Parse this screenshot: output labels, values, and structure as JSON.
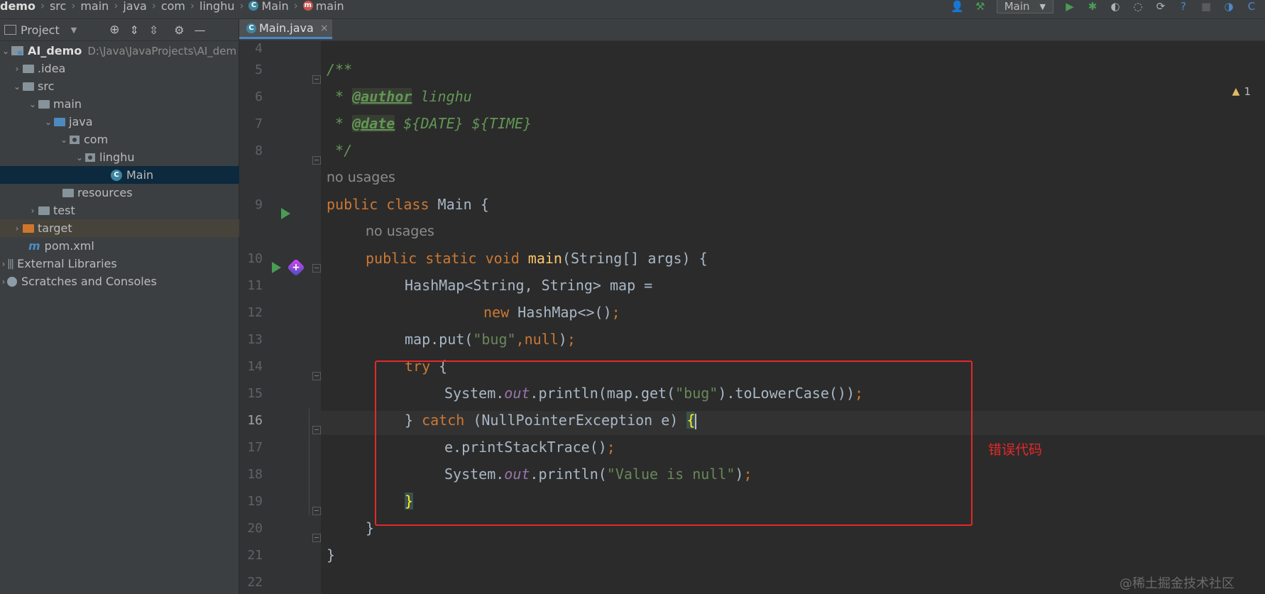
{
  "breadcrumb": {
    "items": [
      "demo",
      "src",
      "main",
      "java",
      "com",
      "linghu",
      "Main",
      "main"
    ]
  },
  "toolbar": {
    "run_config": "Main"
  },
  "project_panel": {
    "title": "Project",
    "tree": [
      {
        "label": "AI_demo",
        "path": "D:\\Java\\JavaProjects\\AI_dem"
      },
      {
        "label": ".idea"
      },
      {
        "label": "src"
      },
      {
        "label": "main"
      },
      {
        "label": "java"
      },
      {
        "label": "com"
      },
      {
        "label": "linghu"
      },
      {
        "label": "Main"
      },
      {
        "label": "resources"
      },
      {
        "label": "test"
      },
      {
        "label": "target"
      },
      {
        "label": "pom.xml"
      },
      {
        "label": "External Libraries"
      },
      {
        "label": "Scratches and Consoles"
      }
    ]
  },
  "editor": {
    "tab": "Main.java",
    "tab_close": "×",
    "warning_count": "1",
    "line_numbers": [
      "4",
      "5",
      "6",
      "7",
      "8",
      "9",
      "10",
      "11",
      "12",
      "13",
      "14",
      "15",
      "16",
      "17",
      "18",
      "19",
      "20",
      "21",
      "22"
    ],
    "hints": {
      "no_usages": "no usages"
    },
    "code": {
      "l5": "/**",
      "l6_star": " * ",
      "l6_tag": "@author",
      "l6_rest": " linghu",
      "l7_star": " * ",
      "l7_tag": "@date",
      "l7_rest": " ${DATE} ${TIME}",
      "l8": " */",
      "l9_kw": "public class",
      "l9_rest": " Main {",
      "l10_kw": "public static void",
      "l10_fn": "main",
      "l10_rest": "(String[] args) {",
      "l11": "HashMap<String, String> map =",
      "l12_kw": "new",
      "l12_rest": " HashMap<>()",
      "l13_a": "map.put(",
      "l13_str": "\"bug\"",
      "l13_comma": ",",
      "l13_kw": "null",
      "l13_b": ")",
      "l14_kw": "try",
      "l14_rest": " {",
      "l15_a": "System.",
      "l15_out": "out",
      "l15_b": ".println(map.get(",
      "l15_str": "\"bug\"",
      "l15_c": ").toLowerCase())",
      "l16_a": "} ",
      "l16_kw": "catch",
      "l16_b": " (NullPointerException e) ",
      "l16_brace": "{",
      "l17": "e.printStackTrace()",
      "l18_a": "System.",
      "l18_out": "out",
      "l18_b": ".println(",
      "l18_str": "\"Value is null\"",
      "l18_c": ")",
      "l19_brace": "}",
      "l20": "}",
      "l21": "}",
      "semicolon": ";"
    }
  },
  "annotation": {
    "text": "错误代码",
    "color": "#e62828"
  },
  "watermark": "@稀土掘金技术社区",
  "colors": {
    "keyword": "#cc7832",
    "function": "#ffc66d",
    "string": "#6a8759",
    "static_field": "#9876aa",
    "doc": "#629755",
    "selection": "#0d293e"
  }
}
